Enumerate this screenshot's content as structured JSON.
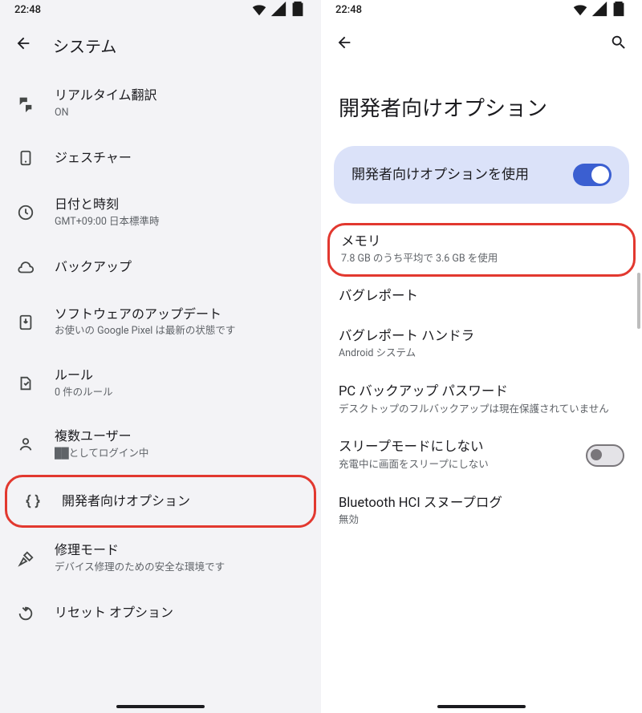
{
  "status": {
    "time": "22:48"
  },
  "left": {
    "title": "システム",
    "items": [
      {
        "icon": "translate",
        "label": "リアルタイム翻訳",
        "sub": "ON"
      },
      {
        "icon": "gesture",
        "label": "ジェスチャー",
        "sub": ""
      },
      {
        "icon": "clock",
        "label": "日付と時刻",
        "sub": "GMT+09:00 日本標準時"
      },
      {
        "icon": "cloud",
        "label": "バックアップ",
        "sub": ""
      },
      {
        "icon": "download",
        "label": "ソフトウェアのアップデート",
        "sub": "お使いの Google Pixel は最新の状態です"
      },
      {
        "icon": "rules",
        "label": "ルール",
        "sub": "0 件のルール"
      },
      {
        "icon": "users",
        "label": "複数ユーザー",
        "sub": "██としてログイン中"
      },
      {
        "icon": "braces",
        "label": "開発者向けオプション",
        "sub": ""
      },
      {
        "icon": "repair",
        "label": "修理モード",
        "sub": "デバイス修理のための安全な環境です"
      },
      {
        "icon": "reset",
        "label": "リセット オプション",
        "sub": ""
      }
    ],
    "highlightIndex": 7
  },
  "right": {
    "title": "開発者向けオプション",
    "masterToggle": {
      "label": "開発者向けオプションを使用",
      "on": true
    },
    "items": [
      {
        "label": "メモリ",
        "sub": "7.8 GB のうち平均で 3.6 GB を使用",
        "switch": null
      },
      {
        "label": "バグレポート",
        "sub": "",
        "switch": null
      },
      {
        "label": "バグレポート ハンドラ",
        "sub": "Android システム",
        "switch": null
      },
      {
        "label": "PC バックアップ パスワード",
        "sub": "デスクトップのフルバックアップは現在保護されていません",
        "switch": null
      },
      {
        "label": "スリープモードにしない",
        "sub": "充電中に画面をスリープにしない",
        "switch": false
      },
      {
        "label": "Bluetooth HCI スヌープログ",
        "sub": "無効",
        "switch": null
      }
    ],
    "highlightIndex": 0
  }
}
